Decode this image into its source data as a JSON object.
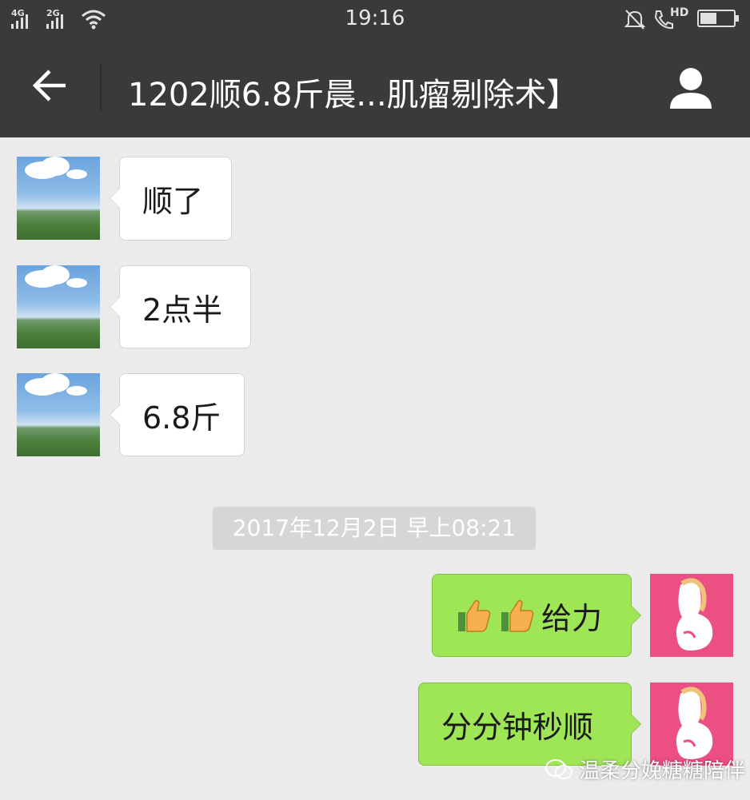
{
  "status_bar": {
    "net1": "4G",
    "net2": "2G",
    "time": "19:16",
    "hd": "HD",
    "icons": [
      "signal-icon",
      "wifi-icon",
      "bell-muted-icon",
      "hd-call-icon",
      "battery-icon"
    ]
  },
  "header": {
    "title": "1202顺6.8斤晨...肌瘤剔除术】",
    "back_icon": "back-arrow-icon",
    "profile_icon": "person-icon"
  },
  "messages": [
    {
      "side": "left",
      "text": "顺了"
    },
    {
      "side": "left",
      "text": "2点半"
    },
    {
      "side": "left",
      "text": "6.8斤"
    }
  ],
  "timestamp": "2017年12月2日 早上08:21",
  "replies": [
    {
      "side": "right",
      "text": "给力",
      "emoji": "thumbs-up-icon"
    },
    {
      "side": "right",
      "text": "分分钟秒顺"
    }
  ],
  "watermark": "温柔分娩糖糖陪伴",
  "colors": {
    "bar": "#3a3a3c",
    "background": "#ebebeb",
    "bubble_self": "#9fe657",
    "avatar_self": "#ec4f82"
  }
}
